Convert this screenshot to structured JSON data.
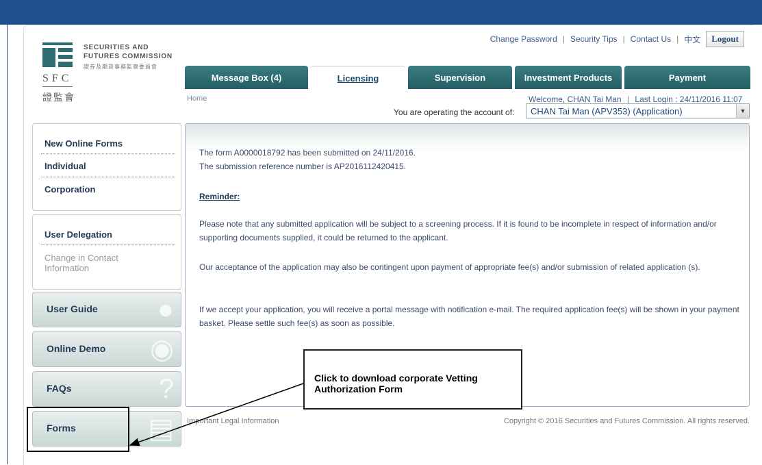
{
  "header": {
    "logo": {
      "en_line1": "SECURITIES AND",
      "en_line2": "FUTURES COMMISSION",
      "cn_line": "證券及期貨事務監察委員會",
      "abbr": "SFC",
      "cn_abbr": "證監會"
    },
    "links": {
      "change_password": "Change Password",
      "security_tips": "Security Tips",
      "contact_us": "Contact Us",
      "chinese": "中文",
      "logout": "Logout",
      "separator": "|"
    }
  },
  "tabs": [
    {
      "label": "Message Box (4)"
    },
    {
      "label": "Licensing",
      "active": true
    },
    {
      "label": "Supervision"
    },
    {
      "label": "Investment Products"
    },
    {
      "label": "Payment"
    }
  ],
  "breadcrumb": {
    "home": "Home"
  },
  "account": {
    "welcome": "Welcome, CHAN Tai Man",
    "last_login": "Last Login : 24/11/2016 11:07",
    "separator": "|",
    "operating_label": "You are operating the account of:",
    "selected": "CHAN Tai Man (APV353) (Application)"
  },
  "sidebar": {
    "forms_group": {
      "heading": "New Online Forms",
      "individual": "Individual",
      "corporation": "Corporation"
    },
    "delegation_group": {
      "user_delegation": "User Delegation",
      "change_contact_line1": "Change in Contact",
      "change_contact_line2": "Information"
    },
    "buttons": {
      "user_guide": "User Guide",
      "online_demo": "Online Demo",
      "faqs": "FAQs",
      "forms": "Forms"
    }
  },
  "content": {
    "line1": "The form A0000018792 has been submitted on 24/11/2016.",
    "line2": "The submission reference number is AP2016112420415.",
    "reminder": "Reminder:",
    "para1": "Please note that any submitted application will be subject to a screening process. If it is found to be incomplete in respect of information and/or supporting documents supplied, it could be returned to the applicant.",
    "para2": "Our acceptance of the application may also be contingent upon payment of appropriate fee(s) and/or submission of related application (s).",
    "para3": "If we accept your application, you will receive a portal message with notification e-mail. The required application fee(s) will be shown in your payment basket. Please settle such fee(s) as soon as possible."
  },
  "annotation": {
    "callout": "Click to download corporate Vetting Authorization Form"
  },
  "footer": {
    "legal": "Important Legal Information",
    "copyright": "Copyright © 2016 Securities and Futures Commission. All rights reserved."
  },
  "colors": {
    "tab": "#2e6e73",
    "banner": "#1e4f8e",
    "link": "#3d5b8a"
  }
}
